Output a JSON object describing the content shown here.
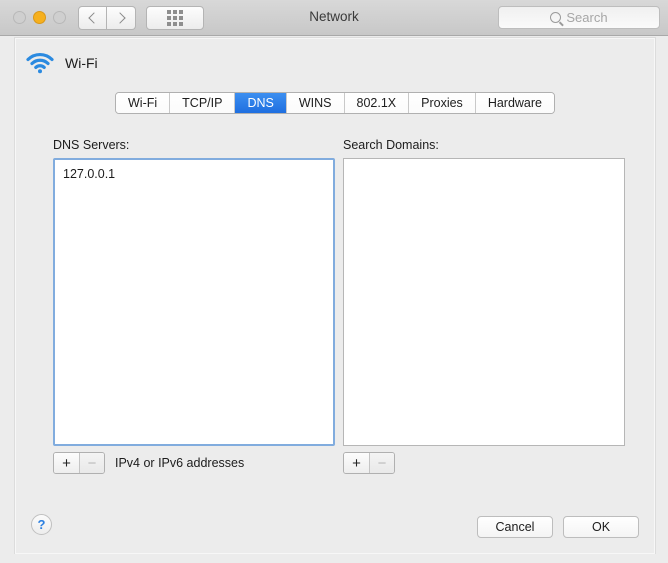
{
  "window": {
    "title": "Network",
    "traffic_lights": [
      {
        "name": "close",
        "color": "#cfcfcf"
      },
      {
        "name": "minimize",
        "color": "#f6b01e"
      },
      {
        "name": "zoom",
        "color": "#cfcfcf"
      }
    ]
  },
  "toolbar": {
    "back_icon": "chevron-left-icon",
    "forward_icon": "chevron-right-icon",
    "show_all_icon": "grid-dots-icon",
    "search": {
      "icon": "search-icon",
      "placeholder": "Search",
      "value": ""
    }
  },
  "interface": {
    "icon": "wifi-icon",
    "label": "Wi-Fi"
  },
  "tabs": [
    {
      "label": "Wi-Fi",
      "active": false
    },
    {
      "label": "TCP/IP",
      "active": false
    },
    {
      "label": "DNS",
      "active": true
    },
    {
      "label": "WINS",
      "active": false
    },
    {
      "label": "802.1X",
      "active": false
    },
    {
      "label": "Proxies",
      "active": false
    },
    {
      "label": "Hardware",
      "active": false
    }
  ],
  "dns_servers": {
    "label": "DNS Servers:",
    "focused": true,
    "items": [
      "127.0.0.1"
    ],
    "add_label": "+",
    "remove_label": "−",
    "remove_enabled": false,
    "hint": "IPv4 or IPv6 addresses"
  },
  "search_domains": {
    "label": "Search Domains:",
    "focused": false,
    "items": [],
    "add_label": "+",
    "remove_label": "−",
    "remove_enabled": false,
    "hint": ""
  },
  "footer": {
    "help_label": "?",
    "cancel_label": "Cancel",
    "ok_label": "OK"
  },
  "colors": {
    "accent": "#1f6fe0",
    "focus_ring": "#81acde",
    "window_bg": "#ececec",
    "help_glyph": "#2b7fe0"
  }
}
